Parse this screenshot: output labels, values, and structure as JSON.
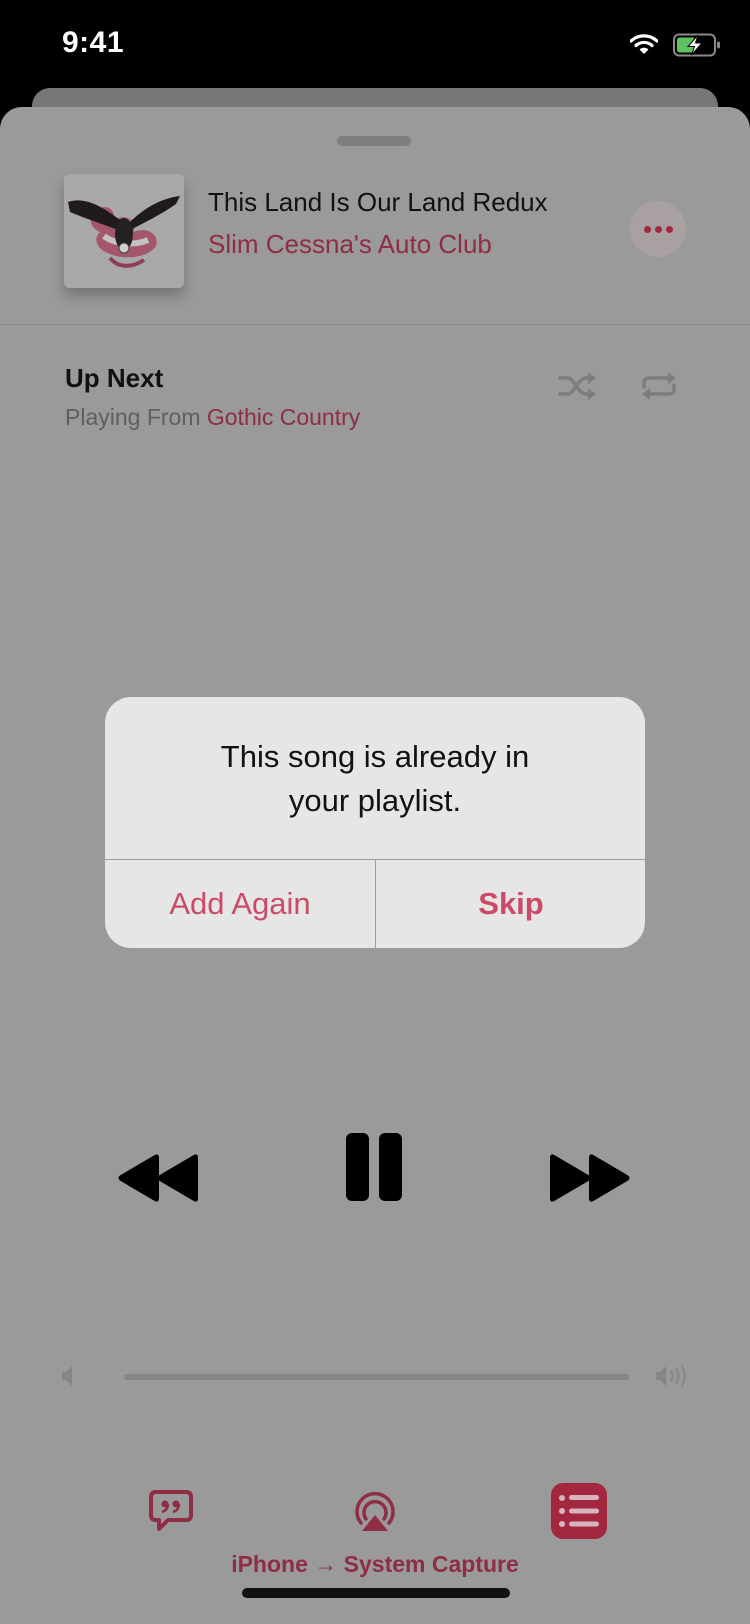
{
  "status_bar": {
    "time": "9:41",
    "wifi_icon": "wifi-icon",
    "battery_icon": "battery-charging-icon",
    "battery_level": 0.5,
    "charging": true
  },
  "now_playing": {
    "track_title": "This Land Is Our Land Redux",
    "artist": "Slim Cessna's Auto Club",
    "more_icon": "ellipsis-icon"
  },
  "up_next": {
    "title": "Up Next",
    "playing_from_prefix": "Playing From ",
    "playing_from_source": "Gothic Country",
    "shuffle_icon": "shuffle-icon",
    "repeat_icon": "repeat-icon"
  },
  "transport": {
    "previous_icon": "rewind-icon",
    "play_pause_icon": "pause-icon",
    "next_icon": "fast-forward-icon"
  },
  "volume": {
    "low_icon": "speaker-low-icon",
    "high_icon": "speaker-high-icon"
  },
  "bottom_bar": {
    "lyrics_icon": "lyrics-quote-icon",
    "airplay_icon": "airplay-audio-icon",
    "queue_icon": "queue-list-icon",
    "output_label": "iPhone → System Capture"
  },
  "alert": {
    "message": "This song is already in your playlist.",
    "buttons": [
      {
        "label": "Add Again",
        "style": "default"
      },
      {
        "label": "Skip",
        "style": "preferred"
      }
    ]
  },
  "colors": {
    "accent": "#cc4a66",
    "accent_dimmed": "#8e2d44",
    "dim_overlay_bg": "#9a9a9a",
    "alert_bg": "#e6e6e6"
  }
}
